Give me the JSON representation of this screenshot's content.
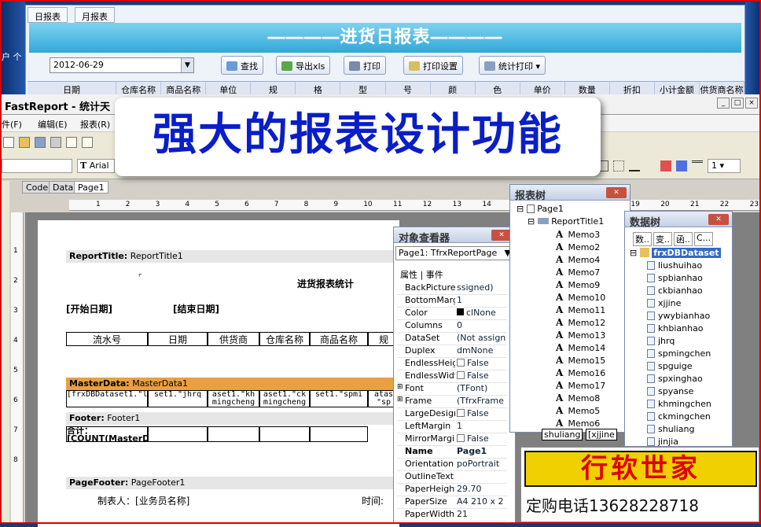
{
  "top_window": {
    "tabs": [
      "日报表",
      "月报表"
    ],
    "banner": "――――进货日报表――――",
    "date_value": "2012-06-29",
    "buttons": {
      "search": "查找",
      "export": "导出xls",
      "print": "打印",
      "print_setup": "打印设置",
      "stat_print": "统计打印"
    },
    "columns": [
      "日期",
      "仓库名称",
      "商品名称",
      "单位",
      "规",
      "格",
      "型",
      "号",
      "颜",
      "色",
      "单价",
      "数量",
      "折扣",
      "小计金额",
      "供货商名称"
    ]
  },
  "left_strip_text": "户 个",
  "designer": {
    "title": "FastReport - 统计天",
    "menu": [
      "件(F)",
      "编辑(E)",
      "报表(R)"
    ],
    "font_name": "Arial",
    "zoom": "1",
    "page_tabs": [
      "Code",
      "Data",
      "Page1"
    ],
    "ruler_numbers": [
      "1",
      "2",
      "3",
      "4",
      "5",
      "6",
      "7",
      "8",
      "9",
      "10",
      "11",
      "12",
      "13",
      "14",
      "15",
      "16",
      "17",
      "18",
      "19",
      "20",
      "21",
      "22",
      "23"
    ],
    "vruler_numbers": [
      "1",
      "2",
      "3",
      "4",
      "5",
      "6",
      "7",
      "8"
    ]
  },
  "overlay_banner": "强大的报表设计功能",
  "report_page": {
    "report_title_band": {
      "label": "ReportTitle:",
      "name": "ReportTitle1"
    },
    "heading": "进货报表统计",
    "start_date": "[开始日期]",
    "end_date": "[结束日期]",
    "header_cells": [
      "流水号",
      "日期",
      "供货商",
      "仓库名称",
      "商品名称",
      "规"
    ],
    "master_band": {
      "label": "MasterData:",
      "name": "MasterData1"
    },
    "master_cells": [
      "[frxDBDataset1.\"liushuihao\"]",
      "set1.\"jhrq",
      "aset1.\"kh mingcheng",
      "aset1.\"ck mingcheng",
      "set1.\"spmi",
      "atas \"sp"
    ],
    "footer_band": {
      "label": "Footer:",
      "name": "Footer1"
    },
    "footer_cell": "合计：[COUNT(MasterData1)]",
    "page_footer_band": {
      "label": "PageFooter:",
      "name": "PageFooter1"
    },
    "maker": "制表人：[业务员名称]",
    "time_label": "时间:"
  },
  "object_inspector": {
    "title": "对象查看器",
    "selector": "Page1: TfrxReportPage",
    "tabs": [
      "属性",
      "事件"
    ],
    "rows": [
      {
        "name": "BackPicture",
        "value": "ssigned)"
      },
      {
        "name": "BottomMargin",
        "value": "1"
      },
      {
        "name": "Color",
        "value": "clNone"
      },
      {
        "name": "Columns",
        "value": "0"
      },
      {
        "name": "DataSet",
        "value": "(Not assign"
      },
      {
        "name": "Duplex",
        "value": "dmNone"
      },
      {
        "name": "EndlessHeigh",
        "value": "False"
      },
      {
        "name": "EndlessWidth",
        "value": "False"
      },
      {
        "name": "Font",
        "value": "(TFont)"
      },
      {
        "name": "Frame",
        "value": "(TfrxFrame"
      },
      {
        "name": "LargeDesign",
        "value": "False"
      },
      {
        "name": "LeftMargin",
        "value": "1"
      },
      {
        "name": "MirrorMargins",
        "value": "False"
      },
      {
        "name": "Name",
        "value": "Page1"
      },
      {
        "name": "Orientation",
        "value": "poPortrait"
      },
      {
        "name": "OutlineText",
        "value": ""
      },
      {
        "name": "PaperHeight",
        "value": "29.70"
      },
      {
        "name": "PaperSize",
        "value": "A4 210 x 2"
      },
      {
        "name": "PaperWidth",
        "value": "21"
      }
    ]
  },
  "report_tree": {
    "title": "报表树",
    "root": "Page1",
    "child": "ReportTitle1",
    "memos": [
      "Memo3",
      "Memo2",
      "Memo4",
      "Memo7",
      "Memo9",
      "Memo10",
      "Memo11",
      "Memo12",
      "Memo13",
      "Memo14",
      "Memo15",
      "Memo16",
      "Memo17",
      "Memo8",
      "Memo5",
      "Memo6"
    ],
    "bottom_text": [
      "shuliang",
      "[xjjine"
    ]
  },
  "data_tree": {
    "title": "数据树",
    "tabs": [
      "数..",
      "变..",
      "函..",
      "C..."
    ],
    "dataset": "frxDBDataset",
    "fields": [
      "liushuihao",
      "spbianhao",
      "ckbianhao",
      "xjjine",
      "ywybianhao",
      "khbianhao",
      "jhrq",
      "spmingchen",
      "spguige",
      "spxinghao",
      "spyanse",
      "khmingchen",
      "ckmingchen",
      "shuliang",
      "jinjia"
    ]
  },
  "ad": {
    "name": "行软世家",
    "phone": "定购电话13628228718"
  },
  "colors": {
    "banner": "#31a8d8",
    "overlay_text": "#0a1ec8",
    "ad_bg": "#f0d000",
    "ad_text": "#d00000",
    "master_band": "#e8a040"
  }
}
